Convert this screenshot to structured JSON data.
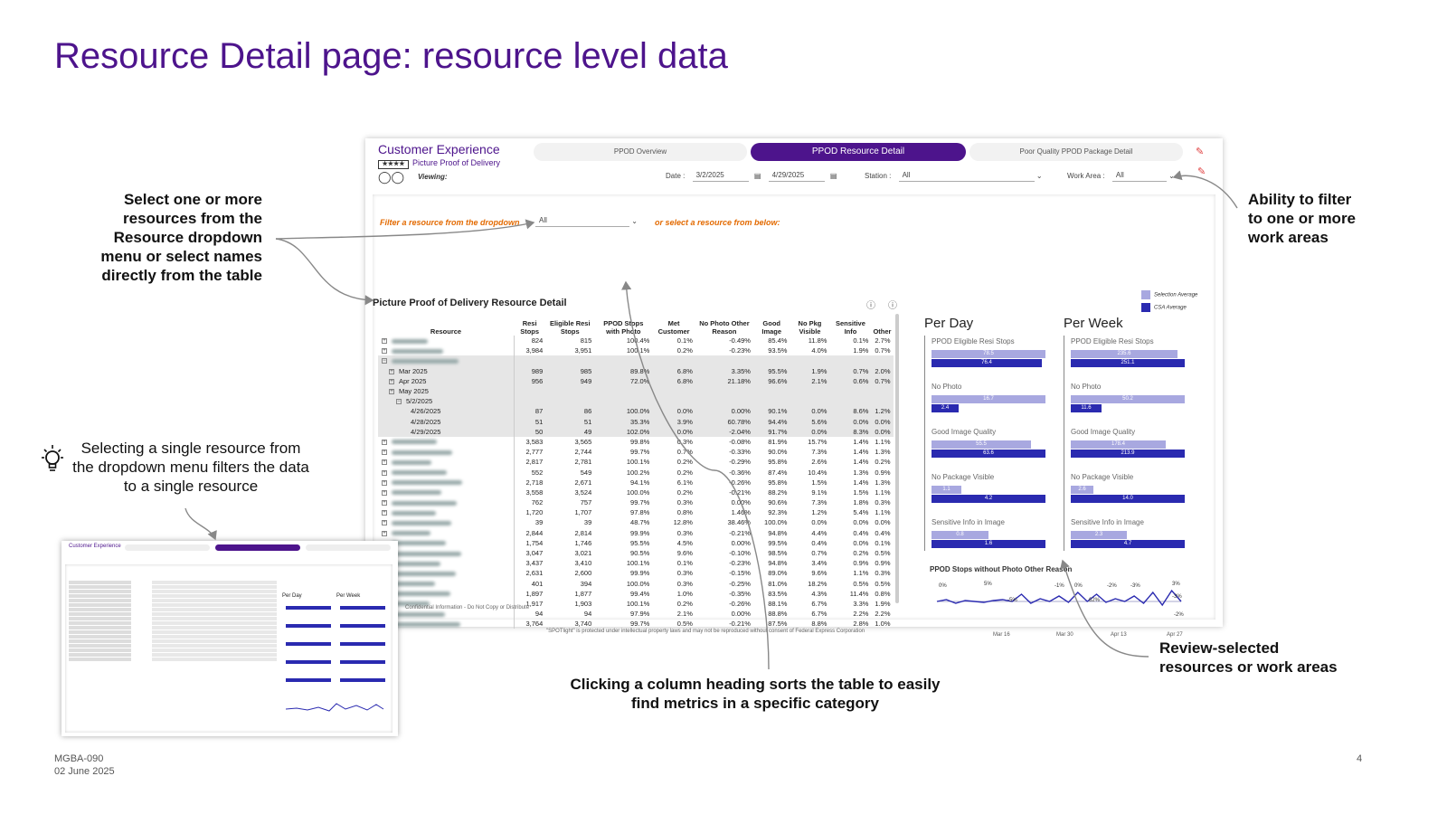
{
  "slide": {
    "title": "Resource Detail page: resource level data",
    "footer_code": "MGBA-090",
    "footer_date": "02 June 2025",
    "page_number": "4"
  },
  "callouts": {
    "select_resources": [
      "Select one or more",
      "resources from the",
      "Resource dropdown",
      "menu or select names",
      "directly from the table"
    ],
    "filter_work_areas": [
      "Ability to filter",
      "to one or more",
      "work areas"
    ],
    "single_resource": [
      "Selecting a single resource from",
      "the dropdown menu filters the data",
      "to a single resource"
    ],
    "sort_column": [
      "Clicking a column heading sorts the table to easily",
      "find metrics in a specific category"
    ],
    "review_selected": [
      "Review-selected",
      "resources or work areas"
    ]
  },
  "dashboard": {
    "brand_title": "Customer Experience",
    "brand_subtitle": "Picture Proof of Delivery",
    "brand_rating": "★★★★",
    "viewing_label": "Viewing:",
    "tabs": [
      "PPOD Overview",
      "PPOD Resource Detail",
      "Poor Quality PPOD Package Detail"
    ],
    "active_tab": 1,
    "filters": {
      "date_label": "Date :",
      "date_from": "3/2/2025",
      "date_to": "4/29/2025",
      "station_label": "Station :",
      "station_value": "All",
      "work_area_label": "Work Area :",
      "work_area_value": "All"
    },
    "resource_filter_prompt": "Filter a resource from the dropdown",
    "resource_filter_value": "All",
    "resource_filter_alt": "or select a resource from below:",
    "table_title": "Picture Proof of Delivery Resource Detail",
    "columns": [
      "Resource",
      "Resi Stops",
      "Eligible Resi Stops",
      "PPOD Stops with Photo",
      "Met Customer",
      "No Photo Other Reason",
      "Good Image",
      "No Pkg Visible",
      "Sensitive Info",
      "Other"
    ],
    "rows": [
      {
        "label": "",
        "kind": "blur",
        "vals": [
          "824",
          "815",
          "100.4%",
          "0.1%",
          "-0.49%",
          "85.4%",
          "11.8%",
          "0.1%",
          "2.7%"
        ]
      },
      {
        "label": "",
        "kind": "blur",
        "vals": [
          "3,984",
          "3,951",
          "100.1%",
          "0.2%",
          "-0.23%",
          "93.5%",
          "4.0%",
          "1.9%",
          "0.7%"
        ]
      },
      {
        "label": "",
        "kind": "blur-hl",
        "vals": [
          "",
          "",
          "",
          "",
          "",
          "",
          "",
          "",
          ""
        ]
      },
      {
        "label": "Mar 2025",
        "kind": "month",
        "vals": [
          "989",
          "985",
          "89.8%",
          "6.8%",
          "3.35%",
          "95.5%",
          "1.9%",
          "0.7%",
          "2.0%"
        ]
      },
      {
        "label": "Apr 2025",
        "kind": "month",
        "vals": [
          "956",
          "949",
          "72.0%",
          "6.8%",
          "21.18%",
          "96.6%",
          "2.1%",
          "0.6%",
          "0.7%"
        ]
      },
      {
        "label": "May 2025",
        "kind": "month",
        "vals": [
          "",
          "",
          "",
          "",
          "",
          "",
          "",
          "",
          ""
        ]
      },
      {
        "label": "5/2/2025",
        "kind": "week",
        "vals": [
          "",
          "",
          "",
          "",
          "",
          "",
          "",
          "",
          ""
        ]
      },
      {
        "label": "4/26/2025",
        "kind": "day",
        "vals": [
          "87",
          "86",
          "100.0%",
          "0.0%",
          "0.00%",
          "90.1%",
          "0.0%",
          "8.6%",
          "1.2%"
        ]
      },
      {
        "label": "4/28/2025",
        "kind": "day",
        "vals": [
          "51",
          "51",
          "35.3%",
          "3.9%",
          "60.78%",
          "94.4%",
          "5.6%",
          "0.0%",
          "0.0%"
        ]
      },
      {
        "label": "4/29/2025",
        "kind": "day",
        "vals": [
          "50",
          "49",
          "102.0%",
          "0.0%",
          "-2.04%",
          "91.7%",
          "0.0%",
          "8.3%",
          "0.0%"
        ]
      },
      {
        "label": "",
        "kind": "blur",
        "vals": [
          "3,583",
          "3,565",
          "99.8%",
          "0.3%",
          "-0.08%",
          "81.9%",
          "15.7%",
          "1.4%",
          "1.1%"
        ]
      },
      {
        "label": "",
        "kind": "blur",
        "vals": [
          "2,777",
          "2,744",
          "99.7%",
          "0.7%",
          "-0.33%",
          "90.0%",
          "7.3%",
          "1.4%",
          "1.3%"
        ]
      },
      {
        "label": "",
        "kind": "blur",
        "vals": [
          "2,817",
          "2,781",
          "100.1%",
          "0.2%",
          "-0.29%",
          "95.8%",
          "2.6%",
          "1.4%",
          "0.2%"
        ]
      },
      {
        "label": "",
        "kind": "blur",
        "vals": [
          "552",
          "549",
          "100.2%",
          "0.2%",
          "-0.36%",
          "87.4%",
          "10.4%",
          "1.3%",
          "0.9%"
        ]
      },
      {
        "label": "",
        "kind": "blur",
        "vals": [
          "2,718",
          "2,671",
          "94.1%",
          "6.1%",
          "-0.26%",
          "95.8%",
          "1.5%",
          "1.4%",
          "1.3%"
        ]
      },
      {
        "label": "",
        "kind": "blur",
        "vals": [
          "3,558",
          "3,524",
          "100.0%",
          "0.2%",
          "-0.21%",
          "88.2%",
          "9.1%",
          "1.5%",
          "1.1%"
        ]
      },
      {
        "label": "",
        "kind": "blur",
        "vals": [
          "762",
          "757",
          "99.7%",
          "0.3%",
          "0.00%",
          "90.6%",
          "7.3%",
          "1.8%",
          "0.3%"
        ]
      },
      {
        "label": "",
        "kind": "blur",
        "vals": [
          "1,720",
          "1,707",
          "97.8%",
          "0.8%",
          "1.46%",
          "92.3%",
          "1.2%",
          "5.4%",
          "1.1%"
        ]
      },
      {
        "label": "",
        "kind": "blur",
        "vals": [
          "39",
          "39",
          "48.7%",
          "12.8%",
          "38.46%",
          "100.0%",
          "0.0%",
          "0.0%",
          "0.0%"
        ]
      },
      {
        "label": "",
        "kind": "blur",
        "vals": [
          "2,844",
          "2,814",
          "99.9%",
          "0.3%",
          "-0.21%",
          "94.8%",
          "4.4%",
          "0.4%",
          "0.4%"
        ]
      },
      {
        "label": "",
        "kind": "blur",
        "vals": [
          "1,754",
          "1,746",
          "95.5%",
          "4.5%",
          "0.00%",
          "99.5%",
          "0.4%",
          "0.0%",
          "0.1%"
        ]
      },
      {
        "label": "",
        "kind": "blur",
        "vals": [
          "3,047",
          "3,021",
          "90.5%",
          "9.6%",
          "-0.10%",
          "98.5%",
          "0.7%",
          "0.2%",
          "0.5%"
        ]
      },
      {
        "label": "",
        "kind": "blur",
        "vals": [
          "3,437",
          "3,410",
          "100.1%",
          "0.1%",
          "-0.23%",
          "94.8%",
          "3.4%",
          "0.9%",
          "0.9%"
        ]
      },
      {
        "label": "",
        "kind": "blur",
        "vals": [
          "2,631",
          "2,600",
          "99.9%",
          "0.3%",
          "-0.15%",
          "89.0%",
          "9.6%",
          "1.1%",
          "0.3%"
        ]
      },
      {
        "label": "",
        "kind": "blur",
        "vals": [
          "401",
          "394",
          "100.0%",
          "0.3%",
          "-0.25%",
          "81.0%",
          "18.2%",
          "0.5%",
          "0.5%"
        ]
      },
      {
        "label": "",
        "kind": "blur",
        "vals": [
          "1,897",
          "1,877",
          "99.4%",
          "1.0%",
          "-0.35%",
          "83.5%",
          "4.3%",
          "11.4%",
          "0.8%"
        ]
      },
      {
        "label": "",
        "kind": "blur",
        "vals": [
          "1,917",
          "1,903",
          "100.1%",
          "0.2%",
          "-0.26%",
          "88.1%",
          "6.7%",
          "3.3%",
          "1.9%"
        ]
      },
      {
        "label": "",
        "kind": "blur",
        "vals": [
          "94",
          "94",
          "97.9%",
          "2.1%",
          "0.00%",
          "88.8%",
          "6.7%",
          "2.2%",
          "2.2%"
        ]
      },
      {
        "label": "",
        "kind": "blur",
        "vals": [
          "3,764",
          "3,740",
          "99.7%",
          "0.5%",
          "-0.21%",
          "87.5%",
          "8.8%",
          "2.8%",
          "1.0%"
        ]
      }
    ],
    "legend": [
      "Selection Average",
      "CSA Average"
    ],
    "per_day": {
      "heading": "Per Day",
      "metrics": [
        {
          "name": "PPOD Eligible Resi Stops",
          "sel": "78.5",
          "csa": "76.4",
          "sel_frac": 1.0,
          "csa_frac": 0.97
        },
        {
          "name": "No Photo",
          "sel": "16.7",
          "csa": "2.4",
          "sel_frac": 1.0,
          "csa_frac": 0.24
        },
        {
          "name": "Good Image Quality",
          "sel": "55.5",
          "csa": "63.6",
          "sel_frac": 0.87,
          "csa_frac": 1.0
        },
        {
          "name": "No Package Visible",
          "sel": "1.1",
          "csa": "4.2",
          "sel_frac": 0.26,
          "csa_frac": 1.0
        },
        {
          "name": "Sensitive Info in Image",
          "sel": "0.8",
          "csa": "1.6",
          "sel_frac": 0.5,
          "csa_frac": 1.0
        }
      ]
    },
    "per_week": {
      "heading": "Per Week",
      "metrics": [
        {
          "name": "PPOD Eligible Resi Stops",
          "sel": "235.6",
          "csa": "251.1",
          "sel_frac": 0.94,
          "csa_frac": 1.0
        },
        {
          "name": "No Photo",
          "sel": "50.2",
          "csa": "11.6",
          "sel_frac": 1.0,
          "csa_frac": 0.27
        },
        {
          "name": "Good Image Quality",
          "sel": "178.4",
          "csa": "213.9",
          "sel_frac": 0.83,
          "csa_frac": 1.0
        },
        {
          "name": "No Package Visible",
          "sel": "2.6",
          "csa": "14.0",
          "sel_frac": 0.2,
          "csa_frac": 1.0
        },
        {
          "name": "Sensitive Info in Image",
          "sel": "2.3",
          "csa": "4.7",
          "sel_frac": 0.49,
          "csa_frac": 1.0
        }
      ]
    },
    "trend": {
      "title": "PPOD Stops without Photo Other Reason",
      "x_labels": [
        "Mar 16",
        "Mar 30",
        "Apr 13",
        "Apr 27"
      ],
      "point_labels": [
        "0%",
        "5%",
        "-5%",
        "-1%",
        "0%",
        "-3%",
        "62%",
        "-2%",
        "3%",
        "-3%",
        "-2%"
      ]
    },
    "confidential": "Confidential Information - Do Not Copy or Distribute",
    "copyright": "\"SPOTlight\" is protected under intellectual property laws and may not be reproduced without consent of Federal Express Corporation"
  },
  "colors": {
    "fedex_purple": "#4d148c",
    "orange": "#e36a00",
    "bar_light": "#a8a8e0",
    "bar_dark": "#2a2ab0"
  },
  "icons": [
    "calendar-icon",
    "chevron-down-icon",
    "eraser-icon",
    "info-icon",
    "lightbulb-icon",
    "people-icon"
  ]
}
